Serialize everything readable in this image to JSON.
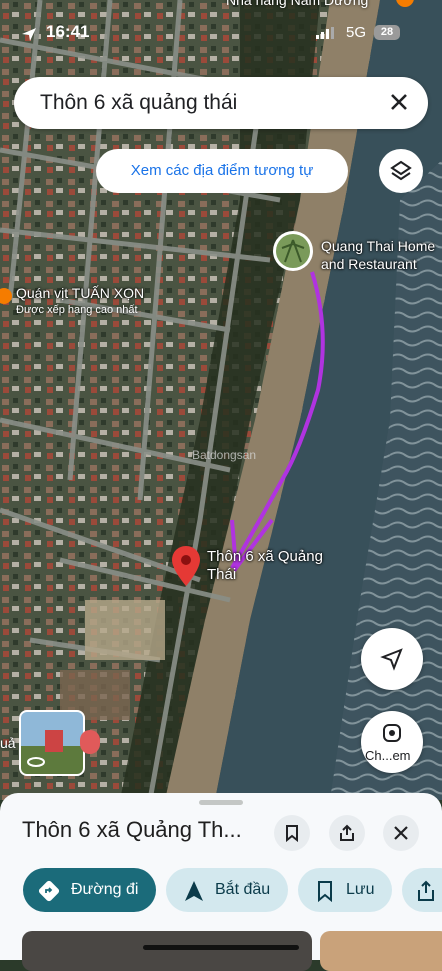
{
  "status_bar": {
    "time": "16:41",
    "network": "5G",
    "battery": "28"
  },
  "map": {
    "top_label": "Nhà hàng Nam Dương",
    "search_query": "Thôn 6 xã quảng thái",
    "similar_places_label": "Xem các địa điểm tương tự",
    "pois": [
      {
        "name": "Quang Thai Home and Restaurant",
        "line1": "Quang Thai Home",
        "line2": "and Restaurant"
      },
      {
        "name": "Quán vịt TUẤN XỌN",
        "subtitle": "Được xếp hạng cao nhất"
      },
      {
        "name": "Thôn 6 xã Quảng Thái",
        "line1": "Thôn 6 xã Quảng",
        "line2": "Thái"
      }
    ],
    "left_edge_label": "uả",
    "streetview_button_label": "Ch...em",
    "watermark": "Batdongsan",
    "colors": {
      "water": "#38505a",
      "sand": "#8f8068",
      "land": "#3f4a3a",
      "pin": "#e53935",
      "annotation_arrow": "#b033e0"
    }
  },
  "sheet": {
    "title": "Thôn 6 xã Quảng Th...",
    "actions": [
      {
        "label": "Đường đi",
        "icon": "directions-icon"
      },
      {
        "label": "Bắt đầu",
        "icon": "navigation-arrow-icon"
      },
      {
        "label": "Lưu",
        "icon": "bookmark-icon"
      }
    ]
  }
}
